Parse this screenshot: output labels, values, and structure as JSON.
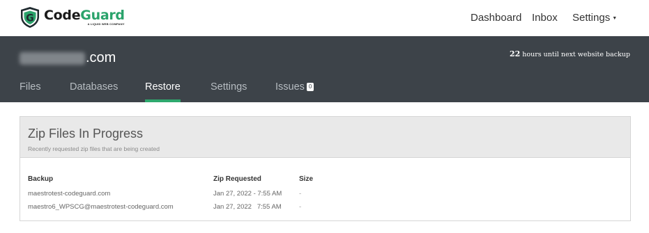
{
  "brand": {
    "name_part1": "Code",
    "name_part2": "Guard",
    "tagline": "A LIQUID WEB COMPANY",
    "logo_letter": "G",
    "accent": "#2aa36b"
  },
  "topnav": {
    "dashboard": "Dashboard",
    "inbox": "Inbox",
    "settings": "Settings"
  },
  "site": {
    "domain_tld": ".com",
    "backup_hours": "22",
    "backup_text": " hours until next website backup"
  },
  "tabs": [
    {
      "label": "Files"
    },
    {
      "label": "Databases"
    },
    {
      "label": "Restore",
      "active": true
    },
    {
      "label": "Settings"
    },
    {
      "label": "Issues",
      "badge": "0"
    }
  ],
  "panel": {
    "title": "Zip Files In Progress",
    "subtitle": "Recently requested zip files that are being created",
    "columns": [
      "Backup",
      "Zip Requested",
      "Size"
    ],
    "rows": [
      {
        "backup": "maestrotest-codeguard.com",
        "zip_requested": "Jan 27, 2022 - 7:55 AM",
        "size": "-"
      },
      {
        "backup": "maestro6_WPSCG@maestrotest-codeguard.com",
        "zip_requested": "Jan 27, 2022   7:55 AM",
        "size": "-"
      }
    ]
  },
  "colors": {
    "header_bg": "#3d4349",
    "active_tab_underline": "#2ea86e"
  }
}
